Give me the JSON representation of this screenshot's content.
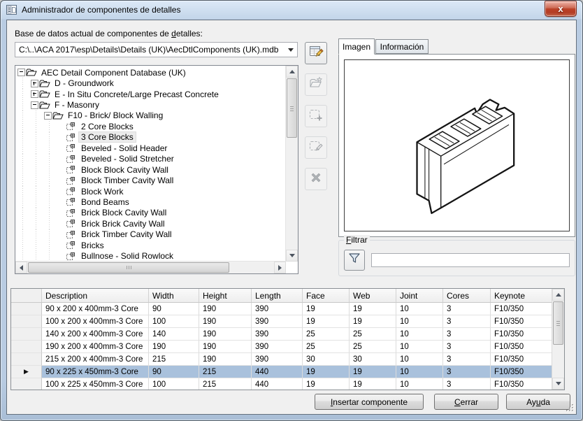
{
  "window": {
    "title": "Administrador de componentes de detalles"
  },
  "colors": {
    "selection_blue": "#a9c1dc",
    "frame_blue": "#bdd0e7",
    "close_red": "#b33d25",
    "client_bg": "#f0f0f0"
  },
  "icons": {
    "close": "x",
    "combo_arrow": "dropdown-triangle",
    "row_selector_arrow": "▶",
    "funnel": "filter-funnel",
    "tree_folder": "open-folder-outline",
    "tree_component": "detail-component-block"
  },
  "database_section": {
    "label": {
      "prefix": "Base de datos actual de componentes de ",
      "accel": "d",
      "suffix": "etalles:"
    },
    "path": "C:\\..\\ACA 2017\\esp\\Details\\Details (UK)\\AecDtlComponents (UK).mdb"
  },
  "toolbar": {
    "buttons": [
      {
        "name": "edit-database-button",
        "icon": "edit-database-icon",
        "enabled": true
      },
      {
        "name": "open-database-button",
        "icon": "new-database-icon",
        "enabled": false
      },
      {
        "name": "add-component-button",
        "icon": "add-component-icon",
        "enabled": false
      },
      {
        "name": "modify-component-button",
        "icon": "edit-component-icon",
        "enabled": false
      },
      {
        "name": "delete-component-button",
        "icon": "delete-component-icon",
        "enabled": false
      }
    ]
  },
  "tree": {
    "items": [
      {
        "label": "AEC Detail Component Database (UK)",
        "level": 0,
        "expander": "minus",
        "icon": "folder",
        "selected": false
      },
      {
        "label": "D - Groundwork",
        "level": 1,
        "expander": "plus",
        "icon": "folder",
        "selected": false
      },
      {
        "label": "E - In Situ Concrete/Large Precast Concrete",
        "level": 1,
        "expander": "plus",
        "icon": "folder",
        "selected": false
      },
      {
        "label": "F - Masonry",
        "level": 1,
        "expander": "minus",
        "icon": "folder",
        "selected": false
      },
      {
        "label": "F10 - Brick/ Block Walling",
        "level": 2,
        "expander": "minus",
        "icon": "folder",
        "selected": false
      },
      {
        "label": "2 Core Blocks",
        "level": 3,
        "expander": null,
        "icon": "component",
        "selected": false
      },
      {
        "label": "3 Core Blocks",
        "level": 3,
        "expander": null,
        "icon": "component",
        "selected": true
      },
      {
        "label": "Beveled - Solid Header",
        "level": 3,
        "expander": null,
        "icon": "component",
        "selected": false
      },
      {
        "label": "Beveled - Solid Stretcher",
        "level": 3,
        "expander": null,
        "icon": "component",
        "selected": false
      },
      {
        "label": "Block Block Cavity Wall",
        "level": 3,
        "expander": null,
        "icon": "component",
        "selected": false
      },
      {
        "label": "Block Timber Cavity Wall",
        "level": 3,
        "expander": null,
        "icon": "component",
        "selected": false
      },
      {
        "label": "Block Work",
        "level": 3,
        "expander": null,
        "icon": "component",
        "selected": false
      },
      {
        "label": "Bond Beams",
        "level": 3,
        "expander": null,
        "icon": "component",
        "selected": false
      },
      {
        "label": "Brick Block Cavity Wall",
        "level": 3,
        "expander": null,
        "icon": "component",
        "selected": false
      },
      {
        "label": "Brick Brick Cavity Wall",
        "level": 3,
        "expander": null,
        "icon": "component",
        "selected": false
      },
      {
        "label": "Brick Timber Cavity Wall",
        "level": 3,
        "expander": null,
        "icon": "component",
        "selected": false
      },
      {
        "label": "Bricks",
        "level": 3,
        "expander": null,
        "icon": "component",
        "selected": false
      },
      {
        "label": "Bullnose - Solid Rowlock",
        "level": 3,
        "expander": null,
        "icon": "component",
        "selected": false
      }
    ]
  },
  "tabs": [
    {
      "label": "Imagen",
      "active": true
    },
    {
      "label": "Información",
      "active": false
    }
  ],
  "filter": {
    "label": {
      "prefix": "",
      "accel": "F",
      "suffix": "iltrar"
    },
    "input_value": ""
  },
  "table": {
    "columns": [
      "Description",
      "Width",
      "Height",
      "Length",
      "Face",
      "Web",
      "Joint",
      "Cores",
      "Keynote"
    ],
    "rows": [
      {
        "selected": false,
        "cells": [
          "90 x 200 x 400mm-3 Core",
          "90",
          "190",
          "390",
          "19",
          "19",
          "10",
          "3",
          "F10/350"
        ]
      },
      {
        "selected": false,
        "cells": [
          "100 x 200 x 400mm-3 Core",
          "100",
          "190",
          "390",
          "19",
          "19",
          "10",
          "3",
          "F10/350"
        ]
      },
      {
        "selected": false,
        "cells": [
          "140 x 200 x 400mm-3 Core",
          "140",
          "190",
          "390",
          "25",
          "25",
          "10",
          "3",
          "F10/350"
        ]
      },
      {
        "selected": false,
        "cells": [
          "190 x 200 x 400mm-3 Core",
          "190",
          "190",
          "390",
          "25",
          "25",
          "10",
          "3",
          "F10/350"
        ]
      },
      {
        "selected": false,
        "cells": [
          "215 x 200 x 400mm-3 Core",
          "215",
          "190",
          "390",
          "30",
          "30",
          "10",
          "3",
          "F10/350"
        ]
      },
      {
        "selected": true,
        "cells": [
          "90 x 225 x 450mm-3 Core",
          "90",
          "215",
          "440",
          "19",
          "19",
          "10",
          "3",
          "F10/350"
        ]
      },
      {
        "selected": false,
        "cells": [
          "100 x 225 x 450mm-3 Core",
          "100",
          "215",
          "440",
          "19",
          "19",
          "10",
          "3",
          "F10/350"
        ]
      }
    ]
  },
  "buttons": {
    "insert": {
      "prefix": "",
      "accel": "I",
      "suffix": "nsertar componente"
    },
    "close": {
      "prefix": "",
      "accel": "C",
      "suffix": "errar"
    },
    "help": {
      "prefix": "Ay",
      "accel": "u",
      "suffix": "da"
    }
  }
}
